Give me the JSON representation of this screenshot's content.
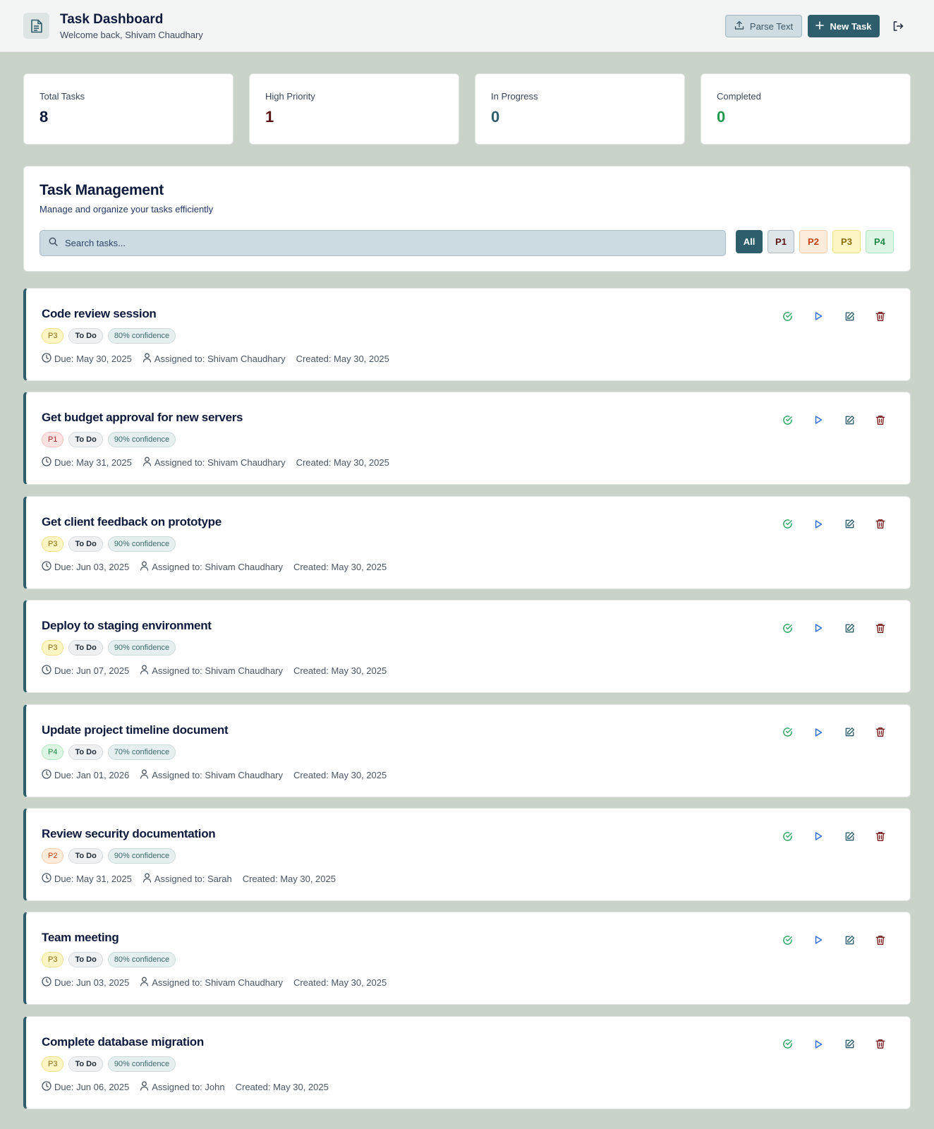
{
  "header": {
    "title": "Task Dashboard",
    "subtitle": "Welcome back, Shivam Chaudhary",
    "parse_label": "Parse Text",
    "new_label": "New Task"
  },
  "stats": [
    {
      "label": "Total Tasks",
      "value": "8",
      "color": "#0f1b3d"
    },
    {
      "label": "High Priority",
      "value": "1",
      "color": "#5c1414"
    },
    {
      "label": "In Progress",
      "value": "0",
      "color": "#2e5e6b"
    },
    {
      "label": "Completed",
      "value": "0",
      "color": "#1f9a4f"
    }
  ],
  "management": {
    "title": "Task Management",
    "subtitle": "Manage and organize your tasks efficiently",
    "search_placeholder": "Search tasks...",
    "filters": [
      {
        "label": "All",
        "active": true
      },
      {
        "label": "P1",
        "active": false
      },
      {
        "label": "P2",
        "active": false
      },
      {
        "label": "P3",
        "active": false
      },
      {
        "label": "P4",
        "active": false
      }
    ]
  },
  "priority_colors": {
    "P1": {
      "bg": "#fde2e2",
      "border": "#f5c2c2",
      "text": "#a4262c"
    },
    "P2": {
      "bg": "#fdebdc",
      "border": "#f6cfae",
      "text": "#c2410c"
    },
    "P3": {
      "bg": "#fdf6c4",
      "border": "#f2e08a",
      "text": "#8a6d0b"
    },
    "P4": {
      "bg": "#dcf6e3",
      "border": "#b3e6c2",
      "text": "#1f8a47"
    }
  },
  "tasks": [
    {
      "title": "Code review session",
      "priority": "P3",
      "status": "To Do",
      "confidence": "80% confidence",
      "due": "Due: May 30, 2025",
      "assigned": "Assigned to: Shivam Chaudhary",
      "created": "Created: May 30, 2025"
    },
    {
      "title": "Get budget approval for new servers",
      "priority": "P1",
      "status": "To Do",
      "confidence": "90% confidence",
      "due": "Due: May 31, 2025",
      "assigned": "Assigned to: Shivam Chaudhary",
      "created": "Created: May 30, 2025"
    },
    {
      "title": "Get client feedback on prototype",
      "priority": "P3",
      "status": "To Do",
      "confidence": "90% confidence",
      "due": "Due: Jun 03, 2025",
      "assigned": "Assigned to: Shivam Chaudhary",
      "created": "Created: May 30, 2025"
    },
    {
      "title": "Deploy to staging environment",
      "priority": "P3",
      "status": "To Do",
      "confidence": "90% confidence",
      "due": "Due: Jun 07, 2025",
      "assigned": "Assigned to: Shivam Chaudhary",
      "created": "Created: May 30, 2025"
    },
    {
      "title": "Update project timeline document",
      "priority": "P4",
      "status": "To Do",
      "confidence": "70% confidence",
      "due": "Due: Jan 01, 2026",
      "assigned": "Assigned to: Shivam Chaudhary",
      "created": "Created: May 30, 2025"
    },
    {
      "title": "Review security documentation",
      "priority": "P2",
      "status": "To Do",
      "confidence": "90% confidence",
      "due": "Due: May 31, 2025",
      "assigned": "Assigned to: Sarah",
      "created": "Created: May 30, 2025"
    },
    {
      "title": "Team meeting",
      "priority": "P3",
      "status": "To Do",
      "confidence": "80% confidence",
      "due": "Due: Jun 03, 2025",
      "assigned": "Assigned to: Shivam Chaudhary",
      "created": "Created: May 30, 2025"
    },
    {
      "title": "Complete database migration",
      "priority": "P3",
      "status": "To Do",
      "confidence": "90% confidence",
      "due": "Due: Jun 06, 2025",
      "assigned": "Assigned to: John",
      "created": "Created: May 30, 2025"
    }
  ],
  "icons": {
    "logo": "document-icon",
    "parse": "upload-icon",
    "new": "plus-icon",
    "logout": "logout-icon",
    "search": "search-icon",
    "complete": "check-circle-icon",
    "start": "play-icon",
    "edit": "edit-icon",
    "delete": "trash-icon",
    "due": "clock-icon",
    "assigned": "user-icon"
  }
}
